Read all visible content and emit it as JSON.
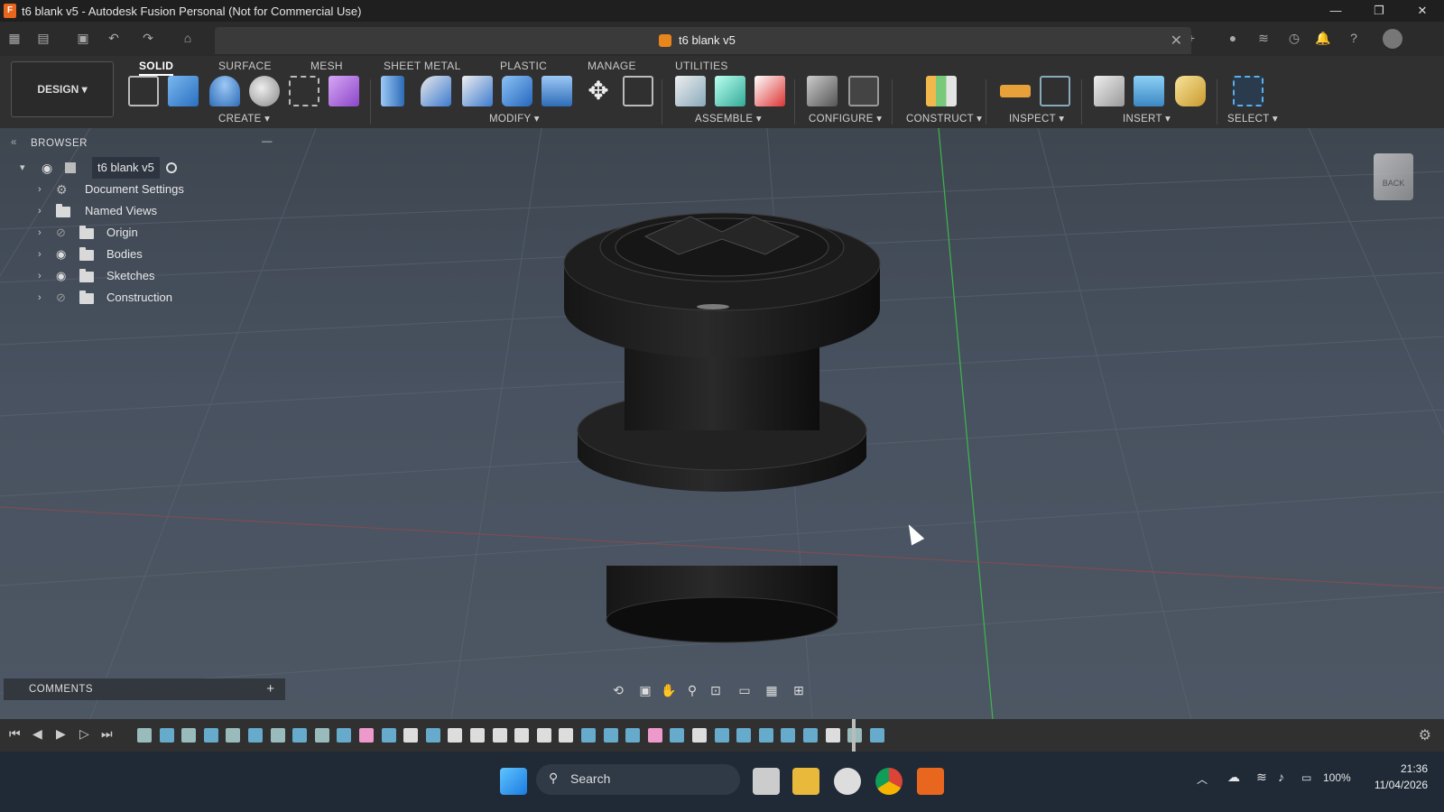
{
  "window": {
    "title": "t6 blank v5 - Autodesk Fusion Personal (Not for Commercial Use)",
    "app_icon_letter": "F",
    "controls": [
      "—",
      "❐",
      "✕"
    ]
  },
  "document_tab": {
    "label": "t6 blank v5",
    "close": "✕"
  },
  "quick_access": {
    "icons": [
      "grid-icon",
      "file-icon",
      "save-icon",
      "undo-icon",
      "redo-icon",
      "home-icon"
    ]
  },
  "toolbar": {
    "workspace_button": "DESIGN ▾",
    "tabs": [
      "SOLID",
      "SURFACE",
      "MESH",
      "SHEET METAL",
      "PLASTIC",
      "MANAGE",
      "UTILITIES"
    ],
    "active_tab": "SOLID",
    "groups": [
      "CREATE ▾",
      "MODIFY ▾",
      "ASSEMBLE ▾",
      "CONFIGURE ▾",
      "CONSTRUCT ▾",
      "INSPECT ▾",
      "INSERT ▾",
      "SELECT ▾"
    ]
  },
  "browser": {
    "header": "BROWSER",
    "collapse": "—",
    "root": "t6 blank v5",
    "items": [
      "Document Settings",
      "Named Views",
      "Origin",
      "Bodies",
      "Sketches",
      "Construction"
    ]
  },
  "comments": {
    "label": "COMMENTS",
    "add": "+"
  },
  "viewcube": {
    "face_label": "BACK"
  },
  "taskbar": {
    "search_label": "Search",
    "battery": "100%",
    "time": "21:36",
    "date": "11/04/2026"
  },
  "colors": {
    "accent": "#e8661e",
    "viewport_top": "#3e4650",
    "viewport_bottom": "#4d5764",
    "toolbar_bg": "#303030"
  }
}
